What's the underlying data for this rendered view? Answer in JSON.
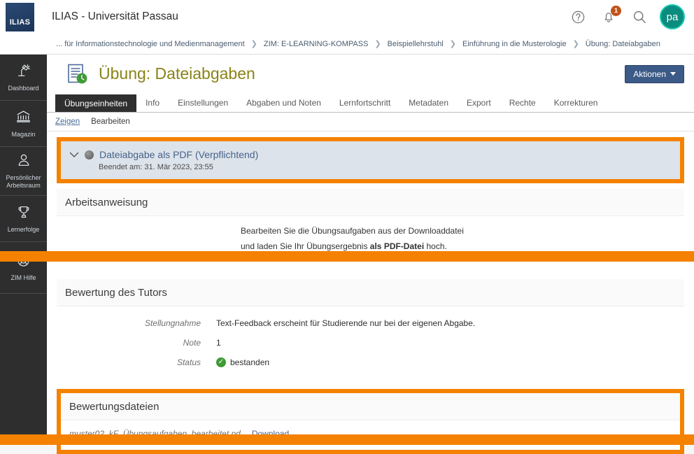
{
  "header": {
    "logo_text": "ILIAS",
    "app_title": "ILIAS - Universität Passau",
    "help_icon": "question-circle-icon",
    "bell_icon": "bell-icon",
    "notification_count": "1",
    "search_icon": "search-icon",
    "avatar_initials": "pa",
    "avatar_color": "#0a8c7e"
  },
  "breadcrumb": {
    "items": [
      "... für Informationstechnologie und Medienmanagement",
      "ZIM: E-LEARNING-KOMPASS",
      "Beispiellehrstuhl",
      "Einführung in die Musterologie",
      "Übung: Dateiabgaben"
    ],
    "separator": "❯"
  },
  "sidebar": {
    "items": [
      {
        "label": "Dashboard",
        "icon": "desk-lamp-icon"
      },
      {
        "label": "Magazin",
        "icon": "bank-building-icon"
      },
      {
        "label": "Persönlicher Arbeitsraum",
        "icon": "person-icon"
      },
      {
        "label": "Lernerfolge",
        "icon": "trophy-icon"
      },
      {
        "label": "ZIM Hilfe",
        "icon": "life-ring-icon"
      }
    ]
  },
  "page": {
    "title": "Übung: Dateiabgaben",
    "title_color": "#8a8317",
    "icon": "exercise-document-icon",
    "actions_label": "Aktionen"
  },
  "tabs": {
    "items": [
      "Übungseinheiten",
      "Info",
      "Einstellungen",
      "Abgaben und Noten",
      "Lernfortschritt",
      "Metadaten",
      "Export",
      "Rechte",
      "Korrekturen"
    ],
    "active": "Übungseinheiten"
  },
  "subtabs": {
    "items": [
      "Zeigen",
      "Bearbeiten"
    ],
    "active": "Zeigen"
  },
  "assignment": {
    "title": "Dateiabgabe als PDF (Verpflichtend)",
    "subtitle": "Beendet am: 31. Mär 2023, 23:55",
    "chevron": "chevron-down-icon",
    "status_dot": "grey-status-dot-icon"
  },
  "instruction": {
    "heading": "Arbeitsanweisung",
    "line1": "Bearbeiten Sie die Übungsaufgaben aus der Downloaddatei",
    "line2_pre": "und laden Sie Ihr Übungsergebnis ",
    "line2_bold": "als PDF-Datei",
    "line2_post": " hoch."
  },
  "evaluation": {
    "heading": "Bewertung des Tutors",
    "rows": [
      {
        "label": "Stellungnahme",
        "value": "Text-Feedback erscheint für Studierende nur bei der eigenen Abgabe."
      },
      {
        "label": "Note",
        "value": "1"
      },
      {
        "label": "Status",
        "value": "bestanden",
        "icon": "green-check-icon"
      }
    ]
  },
  "evaluation_files": {
    "heading": "Bewertungsdateien",
    "file_name": "muster02_kF_Übungsaufgaben_bearbeitet.pd",
    "download_label": "Download"
  },
  "highlight": {
    "color": "#f58100"
  }
}
